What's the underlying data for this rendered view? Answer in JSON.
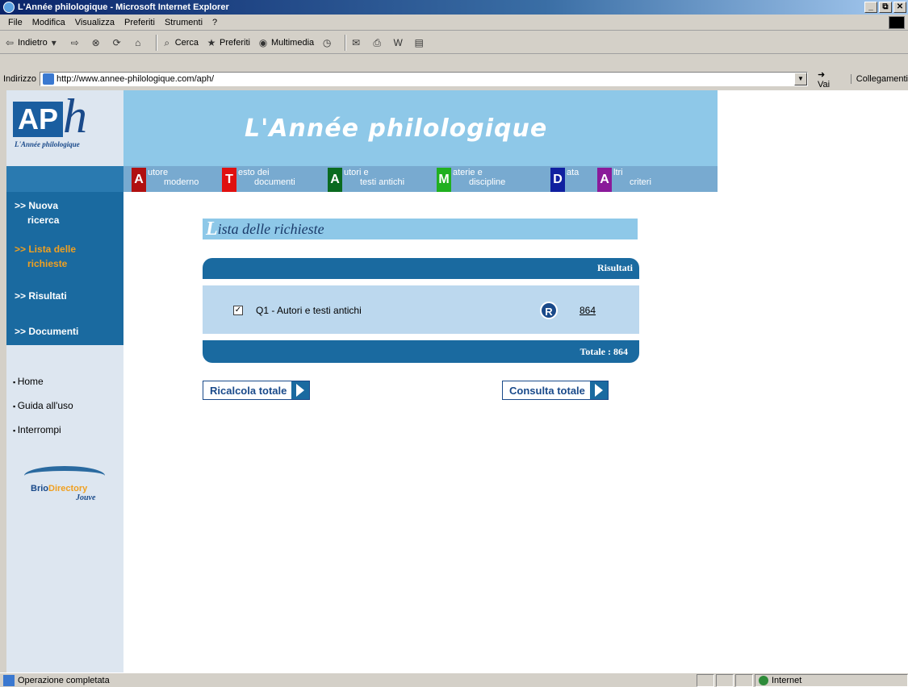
{
  "window": {
    "title": "L'Année philologique - Microsoft Internet Explorer",
    "controls": [
      "_",
      "⧉",
      "✕"
    ]
  },
  "menu": {
    "items": [
      "File",
      "Modifica",
      "Visualizza",
      "Preferiti",
      "Strumenti",
      "?"
    ]
  },
  "toolbar": {
    "back_label": "Indietro",
    "search_label": "Cerca",
    "favorites_label": "Preferiti",
    "media_label": "Multimedia"
  },
  "address": {
    "label": "Indirizzo",
    "url": "http://www.annee-philologique.com/aph/",
    "go_label": "Vai",
    "links_label": "Collegamenti"
  },
  "site": {
    "logo_letters": "AP",
    "logo_h": "h",
    "logo_sub": "L'Année philologique",
    "banner_title": "L'Année philologique",
    "nav": [
      {
        "letter": "A",
        "line1": "utore",
        "line2": "moderno",
        "color": "#b01010"
      },
      {
        "letter": "T",
        "line1": "esto dei",
        "line2": "documenti",
        "color": "#e01010"
      },
      {
        "letter": "A",
        "line1": "utori e",
        "line2": "testi antichi",
        "color": "#0a6a20"
      },
      {
        "letter": "M",
        "line1": "aterie e",
        "line2": "discipline",
        "color": "#20b020"
      },
      {
        "letter": "D",
        "line1": "ata",
        "line2": "",
        "color": "#1020a0"
      },
      {
        "letter": "A",
        "line1": "ltri",
        "line2": "criteri",
        "color": "#8a1a9a"
      }
    ],
    "sidebar": {
      "nuova_ricerca_1": ">> Nuova",
      "nuova_ricerca_2": "ricerca",
      "lista_1": ">> Lista delle",
      "lista_2": "richieste",
      "risultati": ">> Risultati",
      "documenti": ">> Documenti",
      "home": "Home",
      "guida": "Guida all'uso",
      "interrompi": "Interrompi",
      "brio_1": "Brio",
      "brio_2": "Directory",
      "jouve": "Jouve"
    },
    "section_title_cap": "L",
    "section_title_rest": "ista delle richieste",
    "results": {
      "header": "Risultati",
      "query": "Q1 - Autori e testi antichi",
      "checked_mark": "✓",
      "r_badge": "R",
      "count": "864",
      "total": "Totale : 864"
    },
    "buttons": {
      "recalc": "Ricalcola totale",
      "consult": "Consulta totale"
    }
  },
  "status": {
    "message": "Operazione completata",
    "zone": "Internet"
  }
}
